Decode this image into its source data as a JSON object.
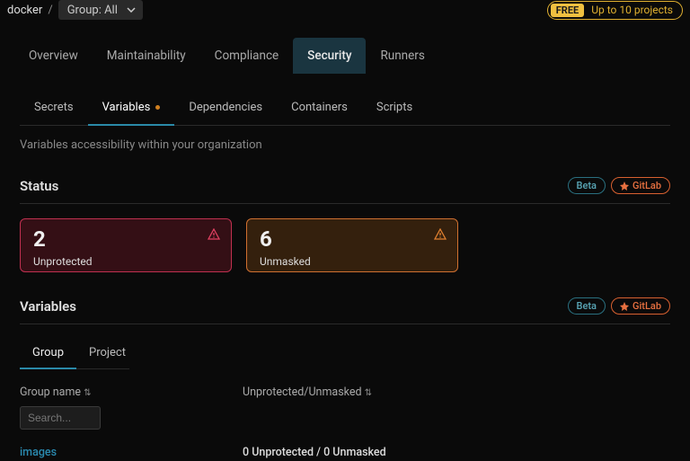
{
  "breadcrumb": {
    "org": "docker",
    "group_select": "Group: All"
  },
  "free_badge": {
    "pill": "FREE",
    "text": "Up to 10 projects"
  },
  "main_tabs": [
    "Overview",
    "Maintainability",
    "Compliance",
    "Security",
    "Runners"
  ],
  "sub_tabs": [
    "Secrets",
    "Variables",
    "Dependencies",
    "Containers",
    "Scripts"
  ],
  "subtitle": "Variables accessibility within your organization",
  "status": {
    "title": "Status",
    "beta": "Beta",
    "gitlab": "GitLab",
    "cards": [
      {
        "count": "2",
        "label": "Unprotected"
      },
      {
        "count": "6",
        "label": "Unmasked"
      }
    ]
  },
  "variables": {
    "title": "Variables",
    "beta": "Beta",
    "gitlab": "GitLab",
    "tabs": [
      "Group",
      "Project"
    ],
    "col_group": "Group name",
    "col_stat": "Unprotected/Unmasked",
    "search_placeholder": "Search...",
    "rows": [
      {
        "name": "images",
        "stat": "0 Unprotected / 0 Unmasked"
      }
    ]
  }
}
